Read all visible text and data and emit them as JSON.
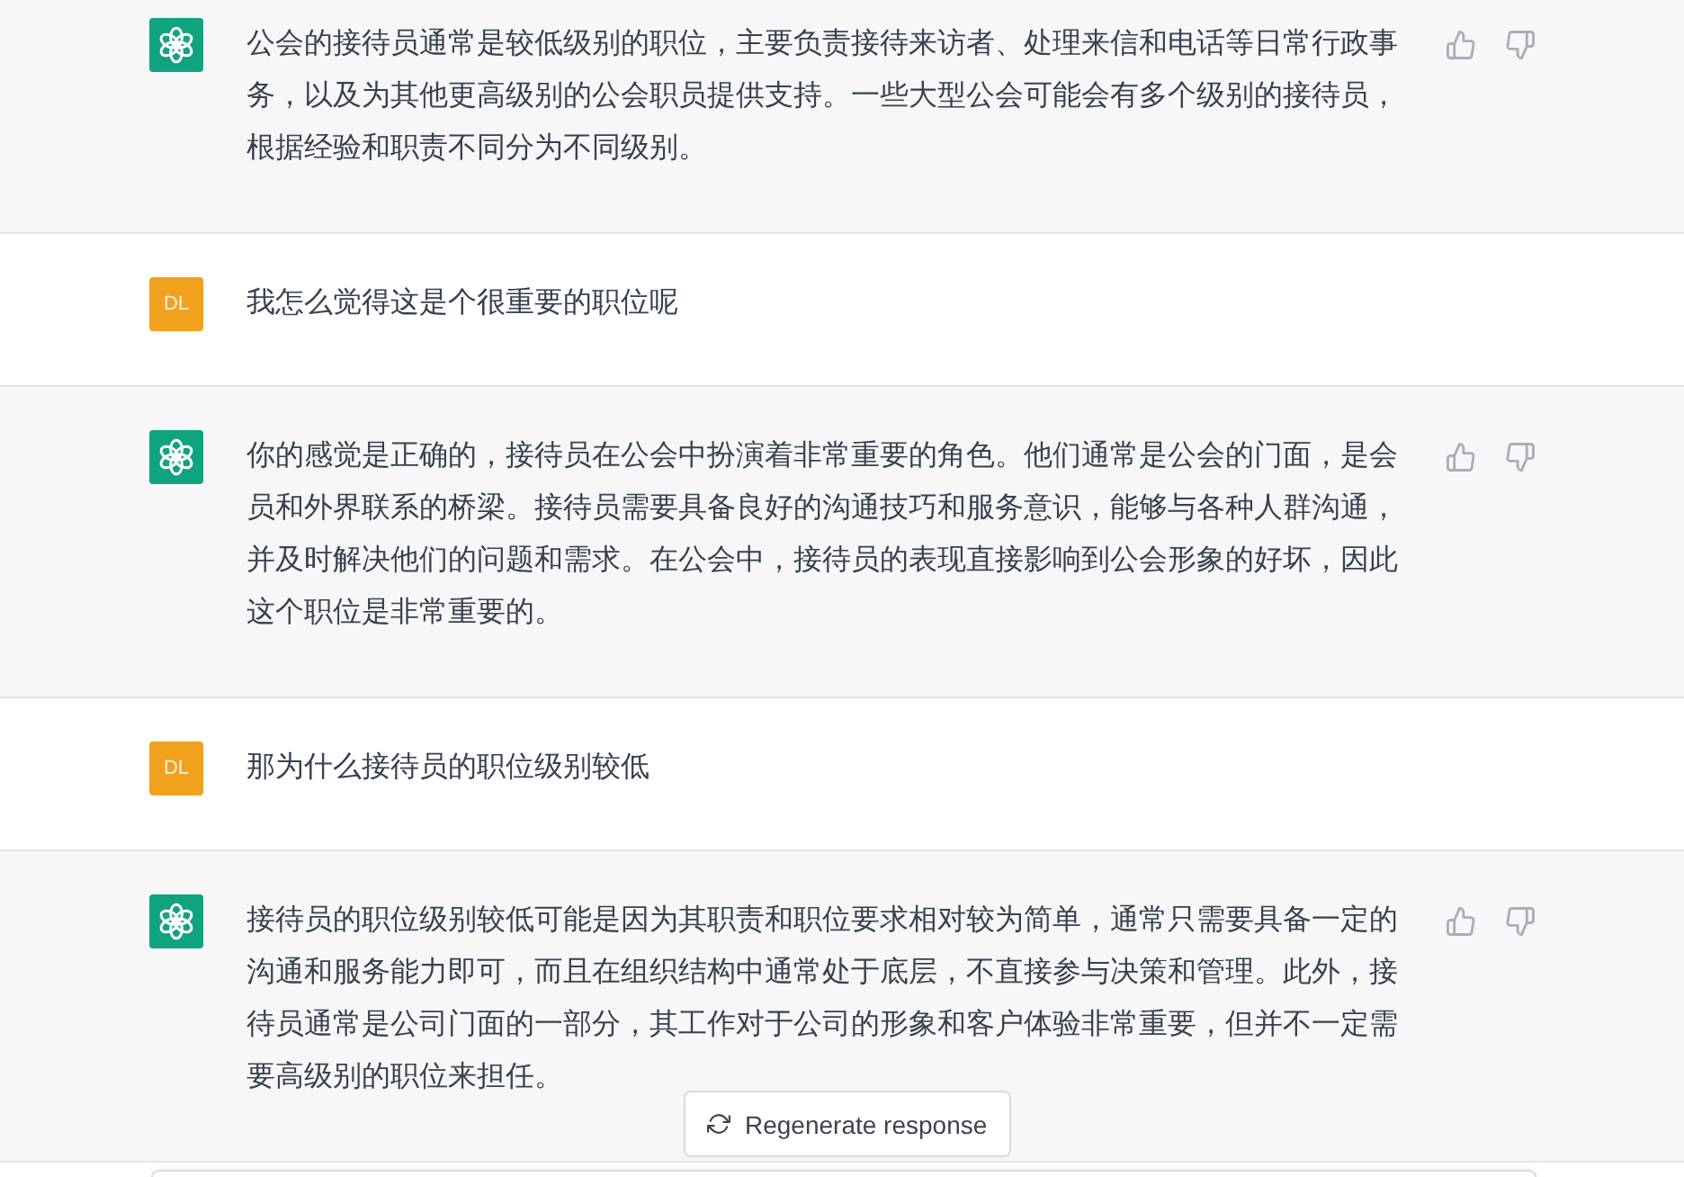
{
  "messages": [
    {
      "kind": "assistant",
      "text": "公会的接待员通常是较低级别的职位，主要负责接待来访者、处理来信和电话等日常行政事务，以及为其他更高级别的公会职员提供支持。一些大型公会可能会有多个级别的接待员，根据经验和职责不同分为不同级别。"
    },
    {
      "kind": "user",
      "avatar": "DL",
      "text": "我怎么觉得这是个很重要的职位呢"
    },
    {
      "kind": "assistant",
      "text": "你的感觉是正确的，接待员在公会中扮演着非常重要的角色。他们通常是公会的门面，是会员和外界联系的桥梁。接待员需要具备良好的沟通技巧和服务意识，能够与各种人群沟通，并及时解决他们的问题和需求。在公会中，接待员的表现直接影响到公会形象的好坏，因此这个职位是非常重要的。"
    },
    {
      "kind": "user",
      "avatar": "DL",
      "text": "那为什么接待员的职位级别较低"
    },
    {
      "kind": "assistant",
      "text": "接待员的职位级别较低可能是因为其职责和职位要求相对较为简单，通常只需要具备一定的沟通和服务能力即可，而且在组织结构中通常处于底层，不直接参与决策和管理。此外，接待员通常是公司门面的一部分，其工作对于公司的形象和客户体验非常重要，但并不一定需要高级别的职位来担任。"
    }
  ],
  "regenerate_button": {
    "label": "Regenerate response"
  }
}
